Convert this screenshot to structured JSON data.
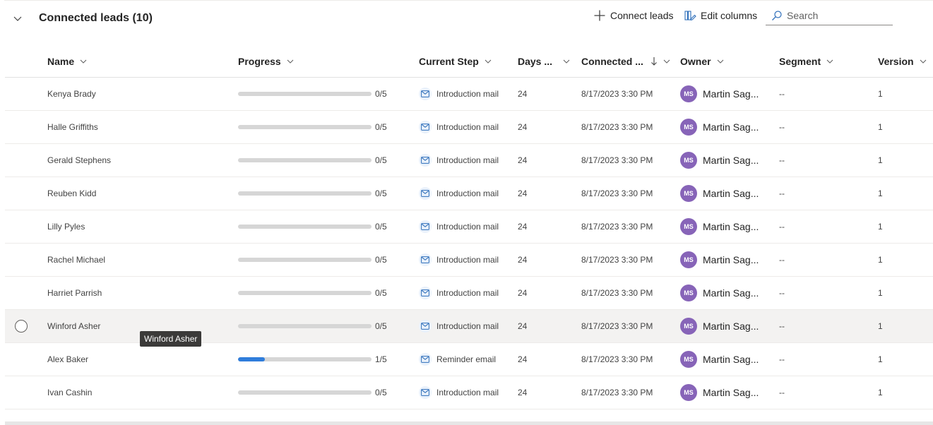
{
  "section": {
    "title": "Connected leads (10)"
  },
  "toolbar": {
    "connect_label": "Connect leads",
    "edit_columns_label": "Edit columns"
  },
  "search": {
    "placeholder": "Search",
    "value": ""
  },
  "columns": {
    "name": "Name",
    "progress": "Progress",
    "current_step": "Current Step",
    "days": "Days ...",
    "connected": "Connected ...",
    "owner": "Owner",
    "segment": "Segment",
    "version": "Version"
  },
  "rows": [
    {
      "name": "Kenya Brady",
      "progress_text": "0/5",
      "progress": 0.0,
      "step": "Introduction mail",
      "days": "24",
      "connected": "8/17/2023 3:30 PM",
      "owner_initials": "MS",
      "owner": "Martin Sag...",
      "segment": "--",
      "version": "1"
    },
    {
      "name": "Halle Griffiths",
      "progress_text": "0/5",
      "progress": 0.0,
      "step": "Introduction mail",
      "days": "24",
      "connected": "8/17/2023 3:30 PM",
      "owner_initials": "MS",
      "owner": "Martin Sag...",
      "segment": "--",
      "version": "1"
    },
    {
      "name": "Gerald Stephens",
      "progress_text": "0/5",
      "progress": 0.0,
      "step": "Introduction mail",
      "days": "24",
      "connected": "8/17/2023 3:30 PM",
      "owner_initials": "MS",
      "owner": "Martin Sag...",
      "segment": "--",
      "version": "1"
    },
    {
      "name": "Reuben Kidd",
      "progress_text": "0/5",
      "progress": 0.0,
      "step": "Introduction mail",
      "days": "24",
      "connected": "8/17/2023 3:30 PM",
      "owner_initials": "MS",
      "owner": "Martin Sag...",
      "segment": "--",
      "version": "1"
    },
    {
      "name": "Lilly Pyles",
      "progress_text": "0/5",
      "progress": 0.0,
      "step": "Introduction mail",
      "days": "24",
      "connected": "8/17/2023 3:30 PM",
      "owner_initials": "MS",
      "owner": "Martin Sag...",
      "segment": "--",
      "version": "1"
    },
    {
      "name": "Rachel Michael",
      "progress_text": "0/5",
      "progress": 0.0,
      "step": "Introduction mail",
      "days": "24",
      "connected": "8/17/2023 3:30 PM",
      "owner_initials": "MS",
      "owner": "Martin Sag...",
      "segment": "--",
      "version": "1"
    },
    {
      "name": "Harriet Parrish",
      "progress_text": "0/5",
      "progress": 0.0,
      "step": "Introduction mail",
      "days": "24",
      "connected": "8/17/2023 3:30 PM",
      "owner_initials": "MS",
      "owner": "Martin Sag...",
      "segment": "--",
      "version": "1"
    },
    {
      "name": "Winford Asher",
      "progress_text": "0/5",
      "progress": 0.0,
      "step": "Introduction mail",
      "days": "24",
      "connected": "8/17/2023 3:30 PM",
      "owner_initials": "MS",
      "owner": "Martin Sag...",
      "segment": "--",
      "version": "1",
      "hovered": true
    },
    {
      "name": "Alex Baker",
      "progress_text": "1/5",
      "progress": 0.2,
      "step": "Reminder email",
      "days": "24",
      "connected": "8/17/2023 3:30 PM",
      "owner_initials": "MS",
      "owner": "Martin Sag...",
      "segment": "--",
      "version": "1"
    },
    {
      "name": "Ivan Cashin",
      "progress_text": "0/5",
      "progress": 0.0,
      "step": "Introduction mail",
      "days": "24",
      "connected": "8/17/2023 3:30 PM",
      "owner_initials": "MS",
      "owner": "Martin Sag...",
      "segment": "--",
      "version": "1"
    }
  ],
  "tooltip": {
    "text": "Winford Asher"
  },
  "colors": {
    "progress_fill": "#2f7ddb",
    "avatar": "#8764b8",
    "hover_row": "#f3f2f1"
  },
  "icons": {
    "collapse": "chevron-down-icon",
    "connect": "add-icon",
    "edit_columns": "edit-columns-icon",
    "search": "search-icon",
    "step": "mail-icon",
    "sort": "sort-descending-icon"
  }
}
